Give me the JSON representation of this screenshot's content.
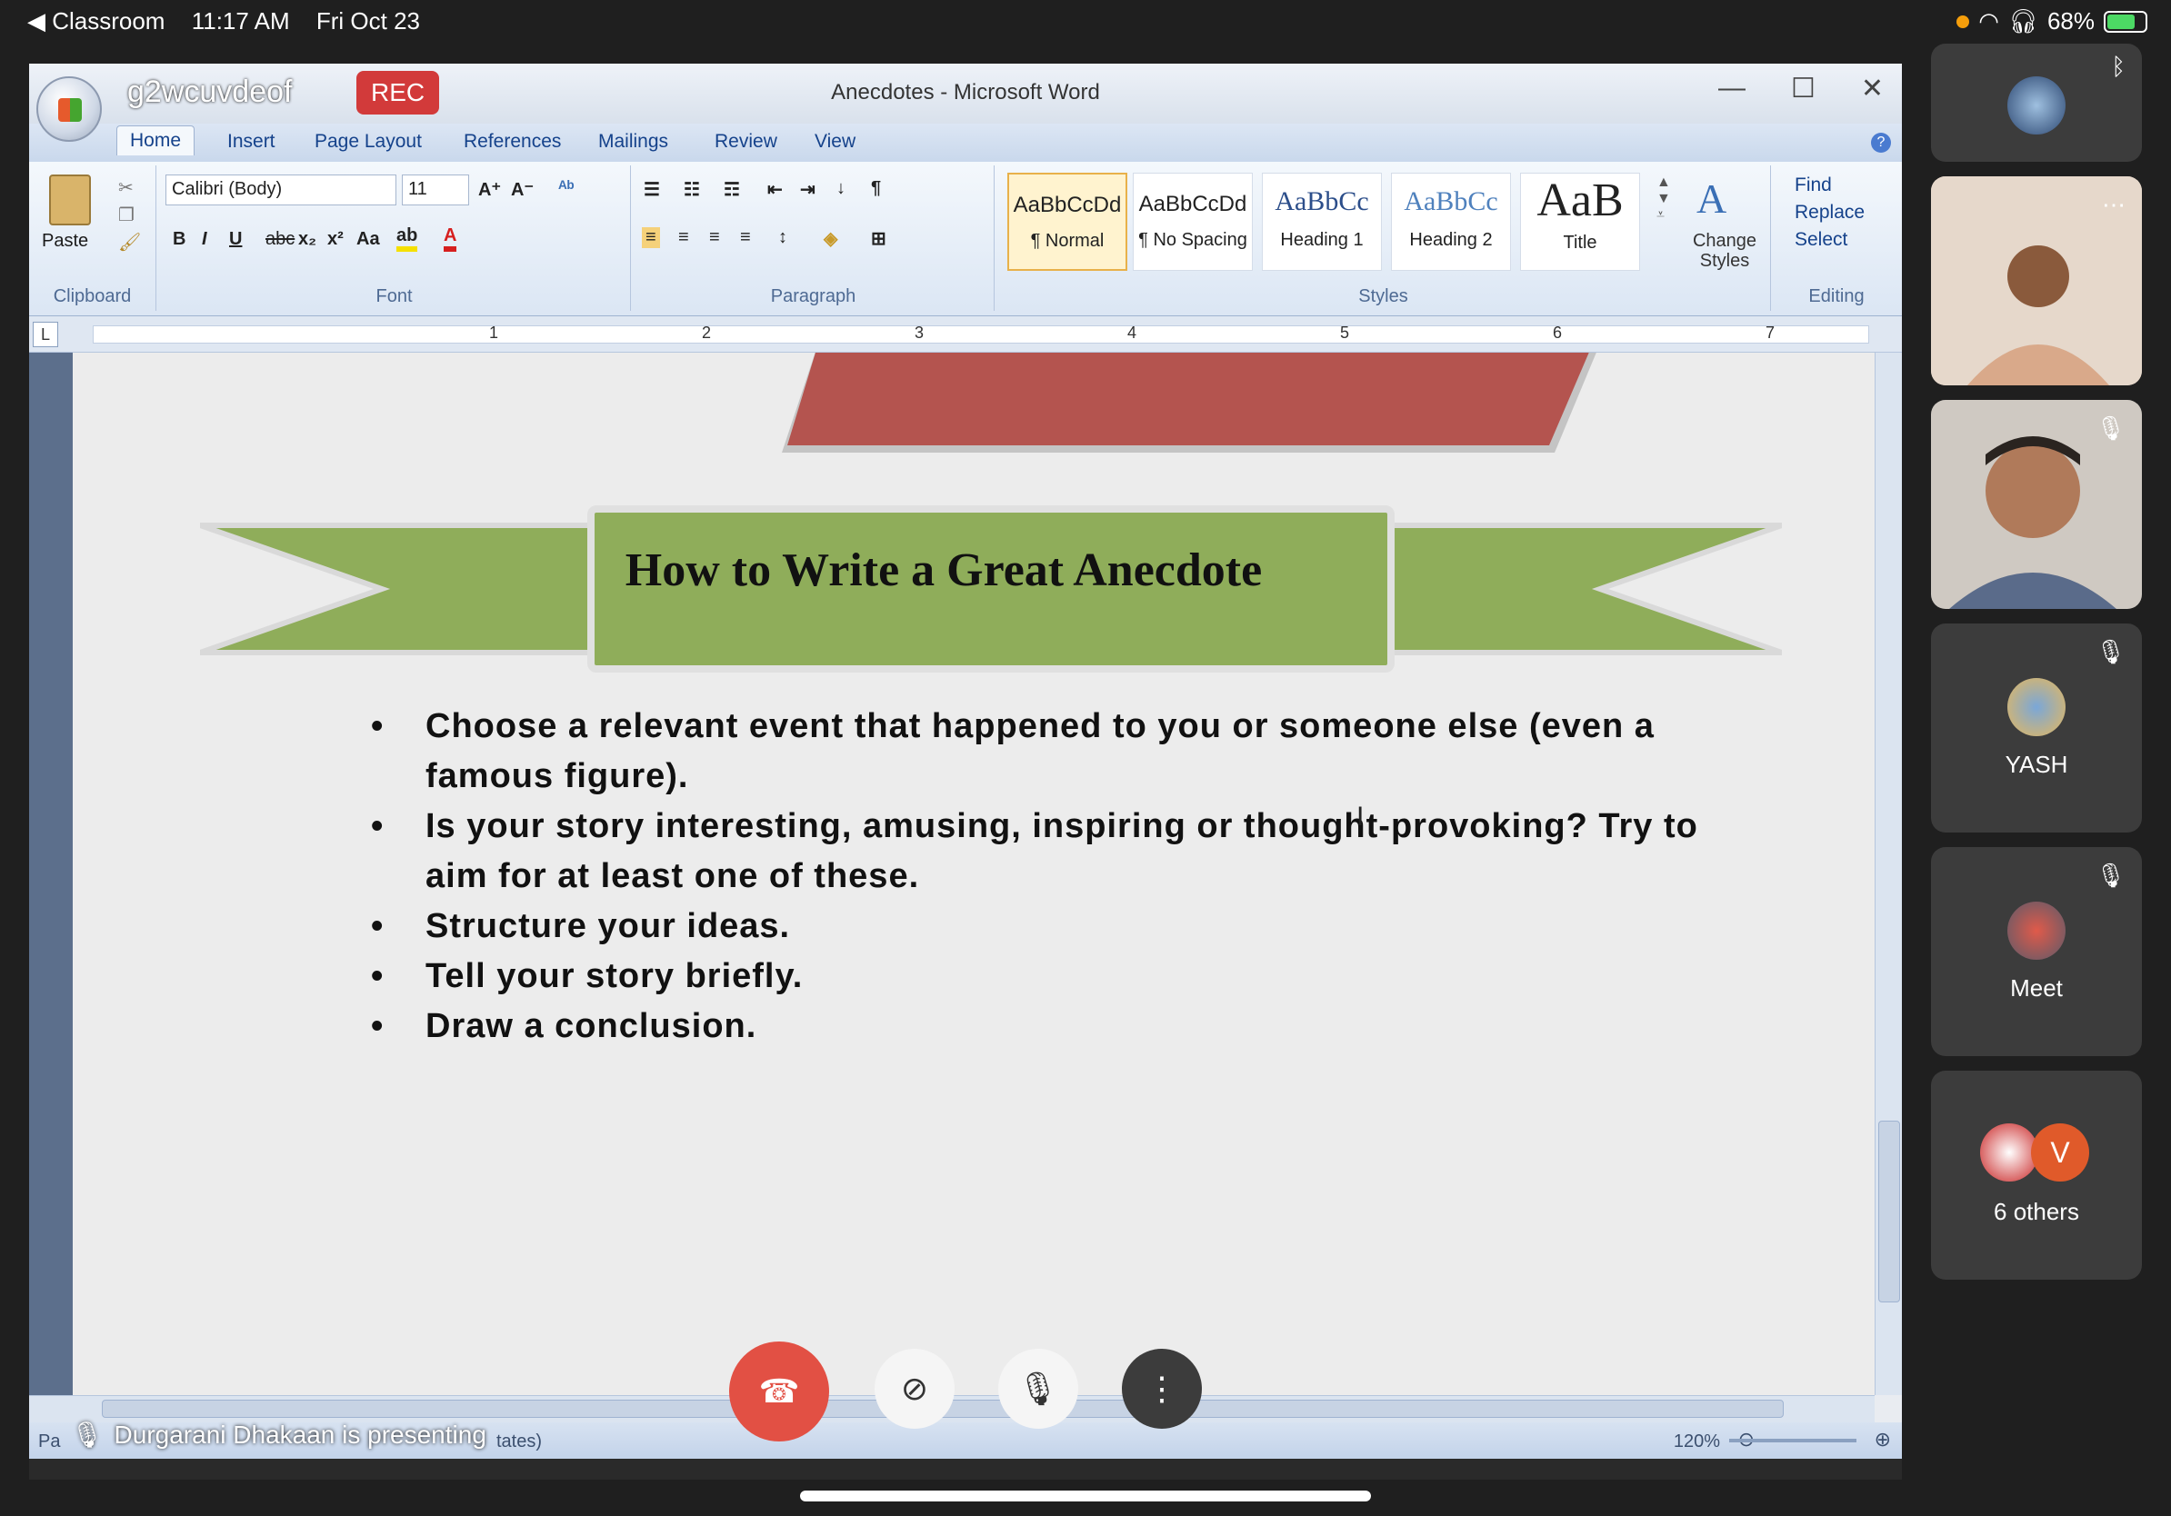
{
  "status_bar": {
    "back_label": "◀ Classroom",
    "time": "11:17 AM",
    "date": "Fri Oct 23",
    "battery": "68%"
  },
  "meeting": {
    "code": "g2wcuvdeof",
    "rec_label": "REC",
    "presenting_text": "Durgarani Dhakaan is presenting"
  },
  "word": {
    "title": "Anecdotes - Microsoft Word",
    "tabs": [
      "Home",
      "Insert",
      "Page Layout",
      "References",
      "Mailings",
      "Review",
      "View"
    ],
    "clipboard": {
      "paste": "Paste",
      "label": "Clipboard"
    },
    "font": {
      "name": "Calibri (Body)",
      "size": "11",
      "label": "Font"
    },
    "paragraph": {
      "label": "Paragraph"
    },
    "styles": {
      "label": "Styles",
      "items": [
        {
          "preview": "AaBbCcDd",
          "name": "¶ Normal"
        },
        {
          "preview": "AaBbCcDd",
          "name": "¶ No Spacing"
        },
        {
          "preview": "AaBbCc",
          "name": "Heading 1"
        },
        {
          "preview": "AaBbCc",
          "name": "Heading 2"
        },
        {
          "preview": "AaB",
          "name": "Title"
        }
      ],
      "change_styles": "Change Styles"
    },
    "editing": {
      "find": "Find",
      "replace": "Replace",
      "select": "Select",
      "label": "Editing"
    },
    "ruler_numbers": [
      "1",
      "2",
      "3",
      "4",
      "5",
      "6",
      "7"
    ],
    "document": {
      "banner_title": "How to Write a Great Anecdote",
      "bullets": [
        "Choose a relevant event that happened to you or someone else (even a famous figure).",
        "Is your story interesting, amusing, inspiring or thought-provoking? Try to aim for at least one of these.",
        "Structure your ideas.",
        "Tell your story briefly.",
        "Draw a conclusion."
      ]
    },
    "status": {
      "page": "Pa",
      "states_fragment": "tates)",
      "zoom": "120%"
    }
  },
  "participants": [
    {
      "name": "",
      "kind": "avatar",
      "muted": false
    },
    {
      "name": "",
      "kind": "video",
      "muted": false
    },
    {
      "name": "",
      "kind": "video",
      "muted": true
    },
    {
      "name": "YASH",
      "kind": "avatar",
      "muted": true
    },
    {
      "name": "Meet",
      "kind": "avatar",
      "muted": true
    },
    {
      "name": "6 others",
      "kind": "group",
      "muted": false,
      "badge": "V"
    }
  ],
  "colors": {
    "end_call": "#e25044",
    "rec": "#d23a3a",
    "banner_green": "#8fad5a",
    "banner_red": "#b4544f"
  }
}
